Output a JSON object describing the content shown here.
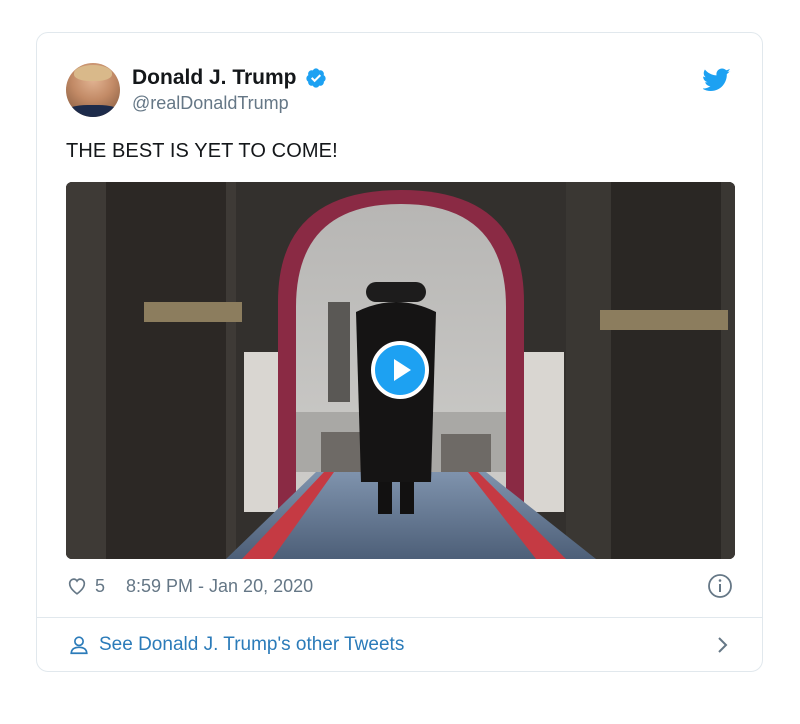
{
  "tweet": {
    "author": {
      "display_name": "Donald J. Trump",
      "handle": "@realDonaldTrump",
      "verified": true,
      "avatar_icon": "user-avatar"
    },
    "text": "THE BEST IS YET TO COME!",
    "media": {
      "type": "video",
      "icon": "play-icon"
    },
    "likes": "5",
    "timestamp": "8:59 PM - Jan 20, 2020"
  },
  "footer": {
    "label": "See Donald J. Trump's other Tweets"
  },
  "icons": {
    "brand": "twitter-bird-icon",
    "verified": "verified-badge-icon",
    "like": "heart-icon",
    "info": "info-icon",
    "person": "person-icon",
    "chevron": "chevron-right-icon"
  },
  "colors": {
    "accent": "#1da1f2",
    "link": "#2b7bb9",
    "muted": "#657786",
    "text": "#14171a",
    "border": "#e1e8ed"
  }
}
